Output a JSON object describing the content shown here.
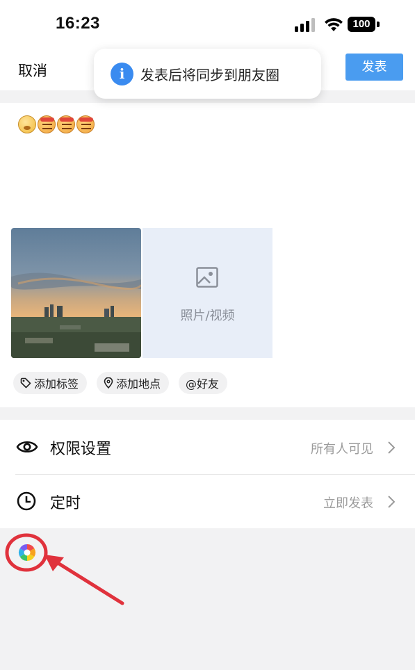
{
  "status_bar": {
    "time": "16:23",
    "battery": "100",
    "icons": [
      "signal-icon",
      "wifi-icon",
      "battery-icon"
    ]
  },
  "header": {
    "cancel_label": "取消",
    "publish_label": "发表"
  },
  "toast": {
    "icon": "info-icon",
    "text": "发表后将同步到朋友圈"
  },
  "compose": {
    "emojis": [
      "shy-emoji",
      "angry-emoji",
      "angry-emoji",
      "angry-emoji"
    ],
    "add_media_label": "照片/视频",
    "chips": [
      {
        "icon": "tag-icon",
        "label": "添加标签"
      },
      {
        "icon": "location-pin-icon",
        "label": "添加地点"
      },
      {
        "icon": "at-icon",
        "label": "@好友"
      }
    ]
  },
  "settings": [
    {
      "icon": "eye-icon",
      "label": "权限设置",
      "value": "所有人可见"
    },
    {
      "icon": "clock-icon",
      "label": "定时",
      "value": "立即发表"
    }
  ],
  "colors": {
    "accent": "#4a9cf0",
    "info_blue": "#3a8bf0",
    "annotation_red": "#e0323c"
  }
}
